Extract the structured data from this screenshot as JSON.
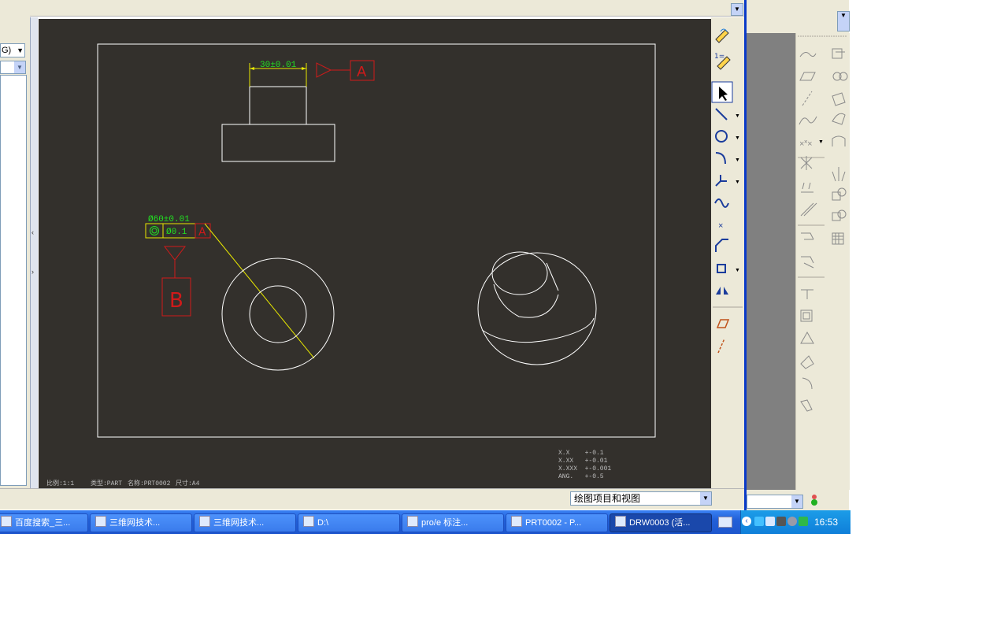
{
  "left_panel": {
    "dropdown_label": "G)",
    "splitter_arrows": [
      "‹",
      "›"
    ]
  },
  "drawing": {
    "dim_top": "30±0.01",
    "datum_a_label": "A",
    "dim_dia": "Ø60±0.01",
    "gtol_tolerance": "Ø0.1",
    "gtol_datum": "A",
    "datum_b_label": "B",
    "tolerance_table": [
      "X.X    +-0.1",
      "X.XX   +-0.01",
      "X.XXX  +-0.001",
      "ANG.   +-0.5"
    ],
    "footer": {
      "scale": "比例:1:1",
      "type": "类型:PART",
      "name": "名称:PRT0002",
      "size": "尺寸:A4"
    }
  },
  "status_bar": {
    "filter_value": "绘图项目和视图"
  },
  "taskbar": {
    "items": [
      {
        "label": "百度搜索_三...",
        "active": false
      },
      {
        "label": "三维网技术...",
        "active": false
      },
      {
        "label": "三维网技术...",
        "active": false
      },
      {
        "label": "D:\\",
        "active": false
      },
      {
        "label": "pro/e 标注...",
        "active": false
      },
      {
        "label": "PRT0002 - P...",
        "active": false
      },
      {
        "label": "DRW0003 (活...",
        "active": true
      }
    ],
    "clock": "16:53"
  },
  "colors": {
    "canvas_bg": "#33302c",
    "drawing_lines": "#ffffff",
    "dimensions": "#22e022",
    "datum_red": "#d01a1a",
    "gtol_box": "#e8e800"
  }
}
